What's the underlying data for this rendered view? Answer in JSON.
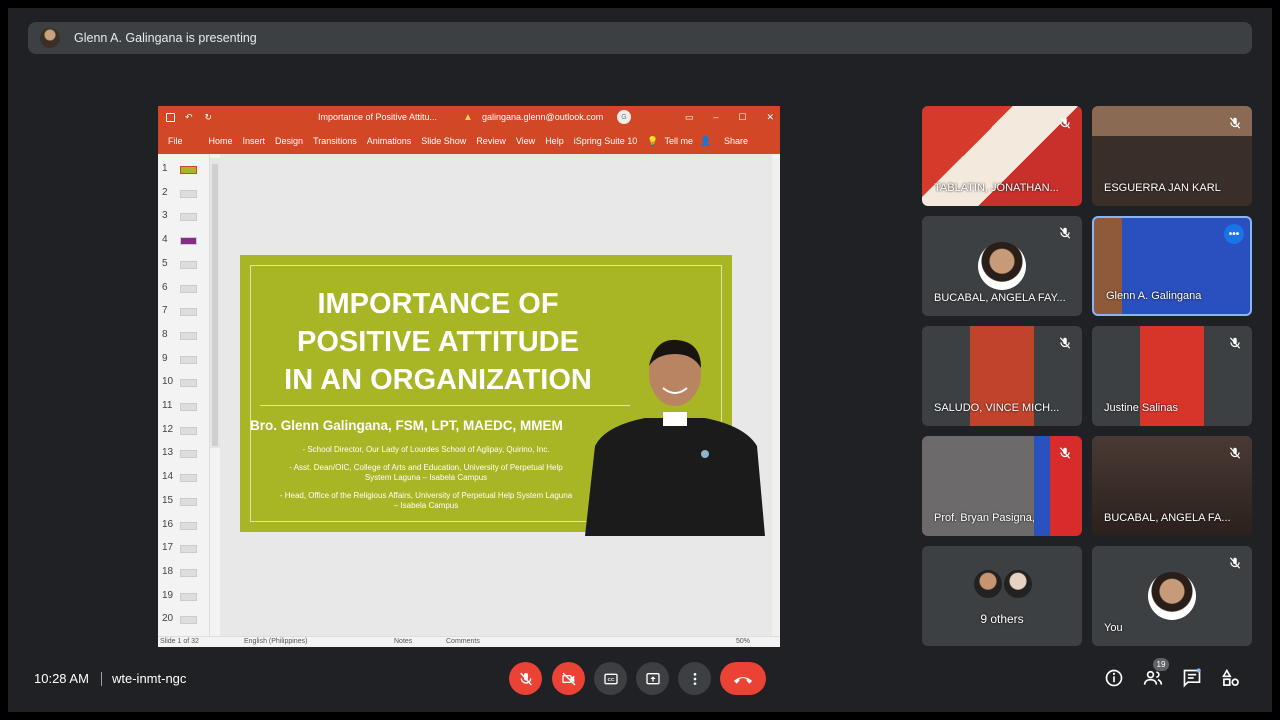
{
  "banner": {
    "text": "Glenn A. Galingana is presenting"
  },
  "ppt": {
    "doc_title": "Importance of Positive Attitu...",
    "account": "galingana.glenn@outlook.com",
    "account_initial": "G",
    "menu": [
      "File",
      "Home",
      "Insert",
      "Design",
      "Transitions",
      "Animations",
      "Slide Show",
      "Review",
      "View",
      "Help",
      "iSpring Suite 10",
      "Tell me"
    ],
    "share": "Share",
    "thumb_numbers": [
      "1",
      "2",
      "3",
      "4",
      "5",
      "6",
      "7",
      "8",
      "9",
      "10",
      "11",
      "12",
      "13",
      "14",
      "15",
      "16",
      "17",
      "18",
      "19",
      "20"
    ],
    "status": {
      "slide": "Slide 1 of 32",
      "language": "English (Philippines)",
      "notes": "Notes",
      "comments": "Comments",
      "zoom": "50%"
    }
  },
  "slide": {
    "title_lines": [
      "IMPORTANCE OF",
      "POSITIVE ATTITUDE",
      "IN AN ORGANIZATION"
    ],
    "name": "Bro. Glenn Galingana, FSM, LPT, MAEDC, MMEM",
    "details": [
      "- School Director, Our Lady of Lourdes School of Aglipay, Quirino, Inc.",
      "- Asst. Dean/OIC, College of Arts and Education, University of Perpetual Help",
      "System Laguna – Isabela Campus",
      "- Head, Office of the Religious Affairs, University of Perpetual Help System Laguna",
      "– Isabela Campus"
    ],
    "colors": {
      "background": "#a8b524"
    }
  },
  "participants": [
    {
      "name": "TABLATIN, JONATHAN...",
      "muted": true
    },
    {
      "name": "ESGUERRA JAN KARL",
      "muted": true
    },
    {
      "name": "BUCABAL, ANGELA FAY...",
      "muted": true
    },
    {
      "name": "Glenn A. Galingana",
      "muted": false,
      "active": true
    },
    {
      "name": "SALUDO, VINCE MICH...",
      "muted": true
    },
    {
      "name": "Justine Salinas",
      "muted": true
    },
    {
      "name": "Prof. Bryan Pasigna,",
      "muted": true
    },
    {
      "name": "BUCABAL, ANGELA FA...",
      "muted": true
    },
    {
      "name": "9 others",
      "muted": false
    },
    {
      "name": "You",
      "muted": true
    }
  ],
  "bottom": {
    "time": "10:28 AM",
    "meeting_code": "wte-inmt-ngc",
    "people_count": "19",
    "icons": [
      "mic-off-icon",
      "camera-off-icon",
      "captions-icon",
      "present-icon",
      "more-icon",
      "hangup-icon",
      "info-icon",
      "people-icon",
      "chat-icon",
      "activities-icon"
    ]
  }
}
